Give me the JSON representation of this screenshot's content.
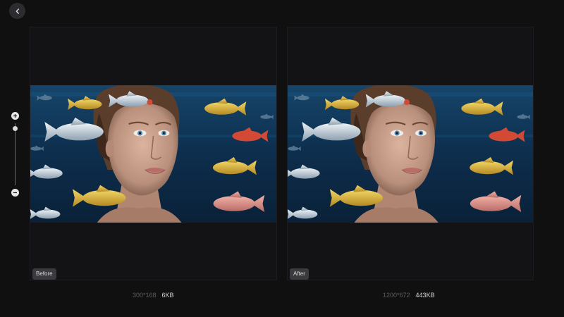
{
  "nav": {
    "back_icon": "chevron-left-icon"
  },
  "zoom": {
    "plus_icon": "plus-icon",
    "minus_icon": "minus-icon",
    "level": 0.92
  },
  "before": {
    "tag": "Before",
    "dimensions": "300*168",
    "file_size": "6KB"
  },
  "after": {
    "tag": "After",
    "dimensions": "1200*672",
    "file_size": "443KB"
  },
  "image": {
    "subject": "woman-face-underwater-with-fish",
    "colors": {
      "water": "#0e2c48",
      "skin": "#c9a08c",
      "hair": "#5b3d2c",
      "fish_yellow": "#d9b43a",
      "fish_silver": "#c9d3dc",
      "fish_red": "#d24a35",
      "fish_pink": "#d98e86"
    }
  },
  "colors": {
    "background": "#101011",
    "panel": "#131316",
    "tag_bg": "#3a3a3f"
  }
}
